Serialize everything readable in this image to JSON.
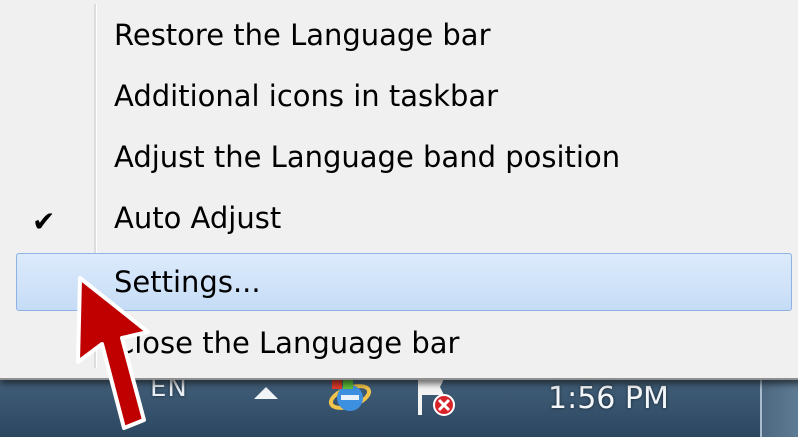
{
  "context_menu": {
    "items": [
      {
        "label": "Restore the Language bar",
        "checked": false,
        "selected": false
      },
      {
        "label": "Additional icons in taskbar",
        "checked": false,
        "selected": false
      },
      {
        "label": "Adjust the Language band position",
        "checked": false,
        "selected": false
      },
      {
        "label": "Auto Adjust",
        "checked": true,
        "selected": false
      },
      {
        "label": "Settings...",
        "checked": false,
        "selected": true
      },
      {
        "label": "Close the Language bar",
        "checked": false,
        "selected": false
      }
    ],
    "check_mark": "✔"
  },
  "taskbar": {
    "language_indicator": "EN",
    "clock": "1:56 PM",
    "icons": [
      "show-hidden-icons-arrow",
      "internet-explorer-icon",
      "action-center-flag-icon"
    ]
  },
  "colors": {
    "menu_background": "#f0f0f0",
    "selection": "#c6dcf6",
    "annotation_arrow": "#c00000"
  }
}
